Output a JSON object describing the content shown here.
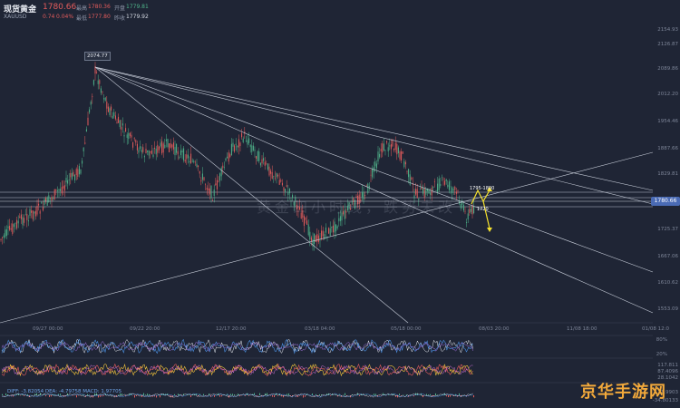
{
  "header": {
    "symbol_name": "现货黄金",
    "dropdown_glyph": "▾",
    "price": "1780.66",
    "code": "XAUUSD",
    "change": "0.74",
    "change_pct": "0.04%",
    "high_label": "最高",
    "high_value": "1780.36",
    "low_label": "最低",
    "low_value": "1777.80",
    "open_label": "开盘",
    "open_value": "1779.81",
    "prev_label": "昨收",
    "prev_value": "1779.92"
  },
  "chart": {
    "peak_tag": "2074.77",
    "current_price": "1780.66",
    "zone_label": "1795-1800",
    "zone_sub": "1770",
    "watermark_text": "黄金四小时线，跌势未改",
    "y_ticks": [
      "2154.93",
      "2126.87",
      "2089.86",
      "2012.20",
      "1954.46",
      "1887.66",
      "1829.81",
      "1725.37",
      "1667.06",
      "1610.62",
      "1553.09"
    ],
    "x_ticks": [
      "09/27 00:00",
      "09/22 20:00",
      "12/17 20:00",
      "03/18 04:00",
      "05/18 00:00",
      "08/03 20:00",
      "11/08 18:00",
      "01/08 12:0"
    ]
  },
  "indicators": {
    "rsi_right": [
      "80%",
      "20%"
    ],
    "stoch_right": [
      "117.811",
      "87.4096",
      "28.1042"
    ],
    "macd_label": "DIFF: -3.82054  DEA: -4.79758  MACD: 1.97705",
    "macd_right": [
      "1.9903",
      "-34.80133"
    ]
  },
  "colors": {
    "background": "#1f2535",
    "up": "#4fb38a",
    "down": "#e45c5c",
    "line": "#9aa3b5",
    "accent": "#4a6bb5",
    "arrow": "#f5e12d",
    "watermark": "#f2a93b"
  },
  "watermark": "京华手游网"
}
